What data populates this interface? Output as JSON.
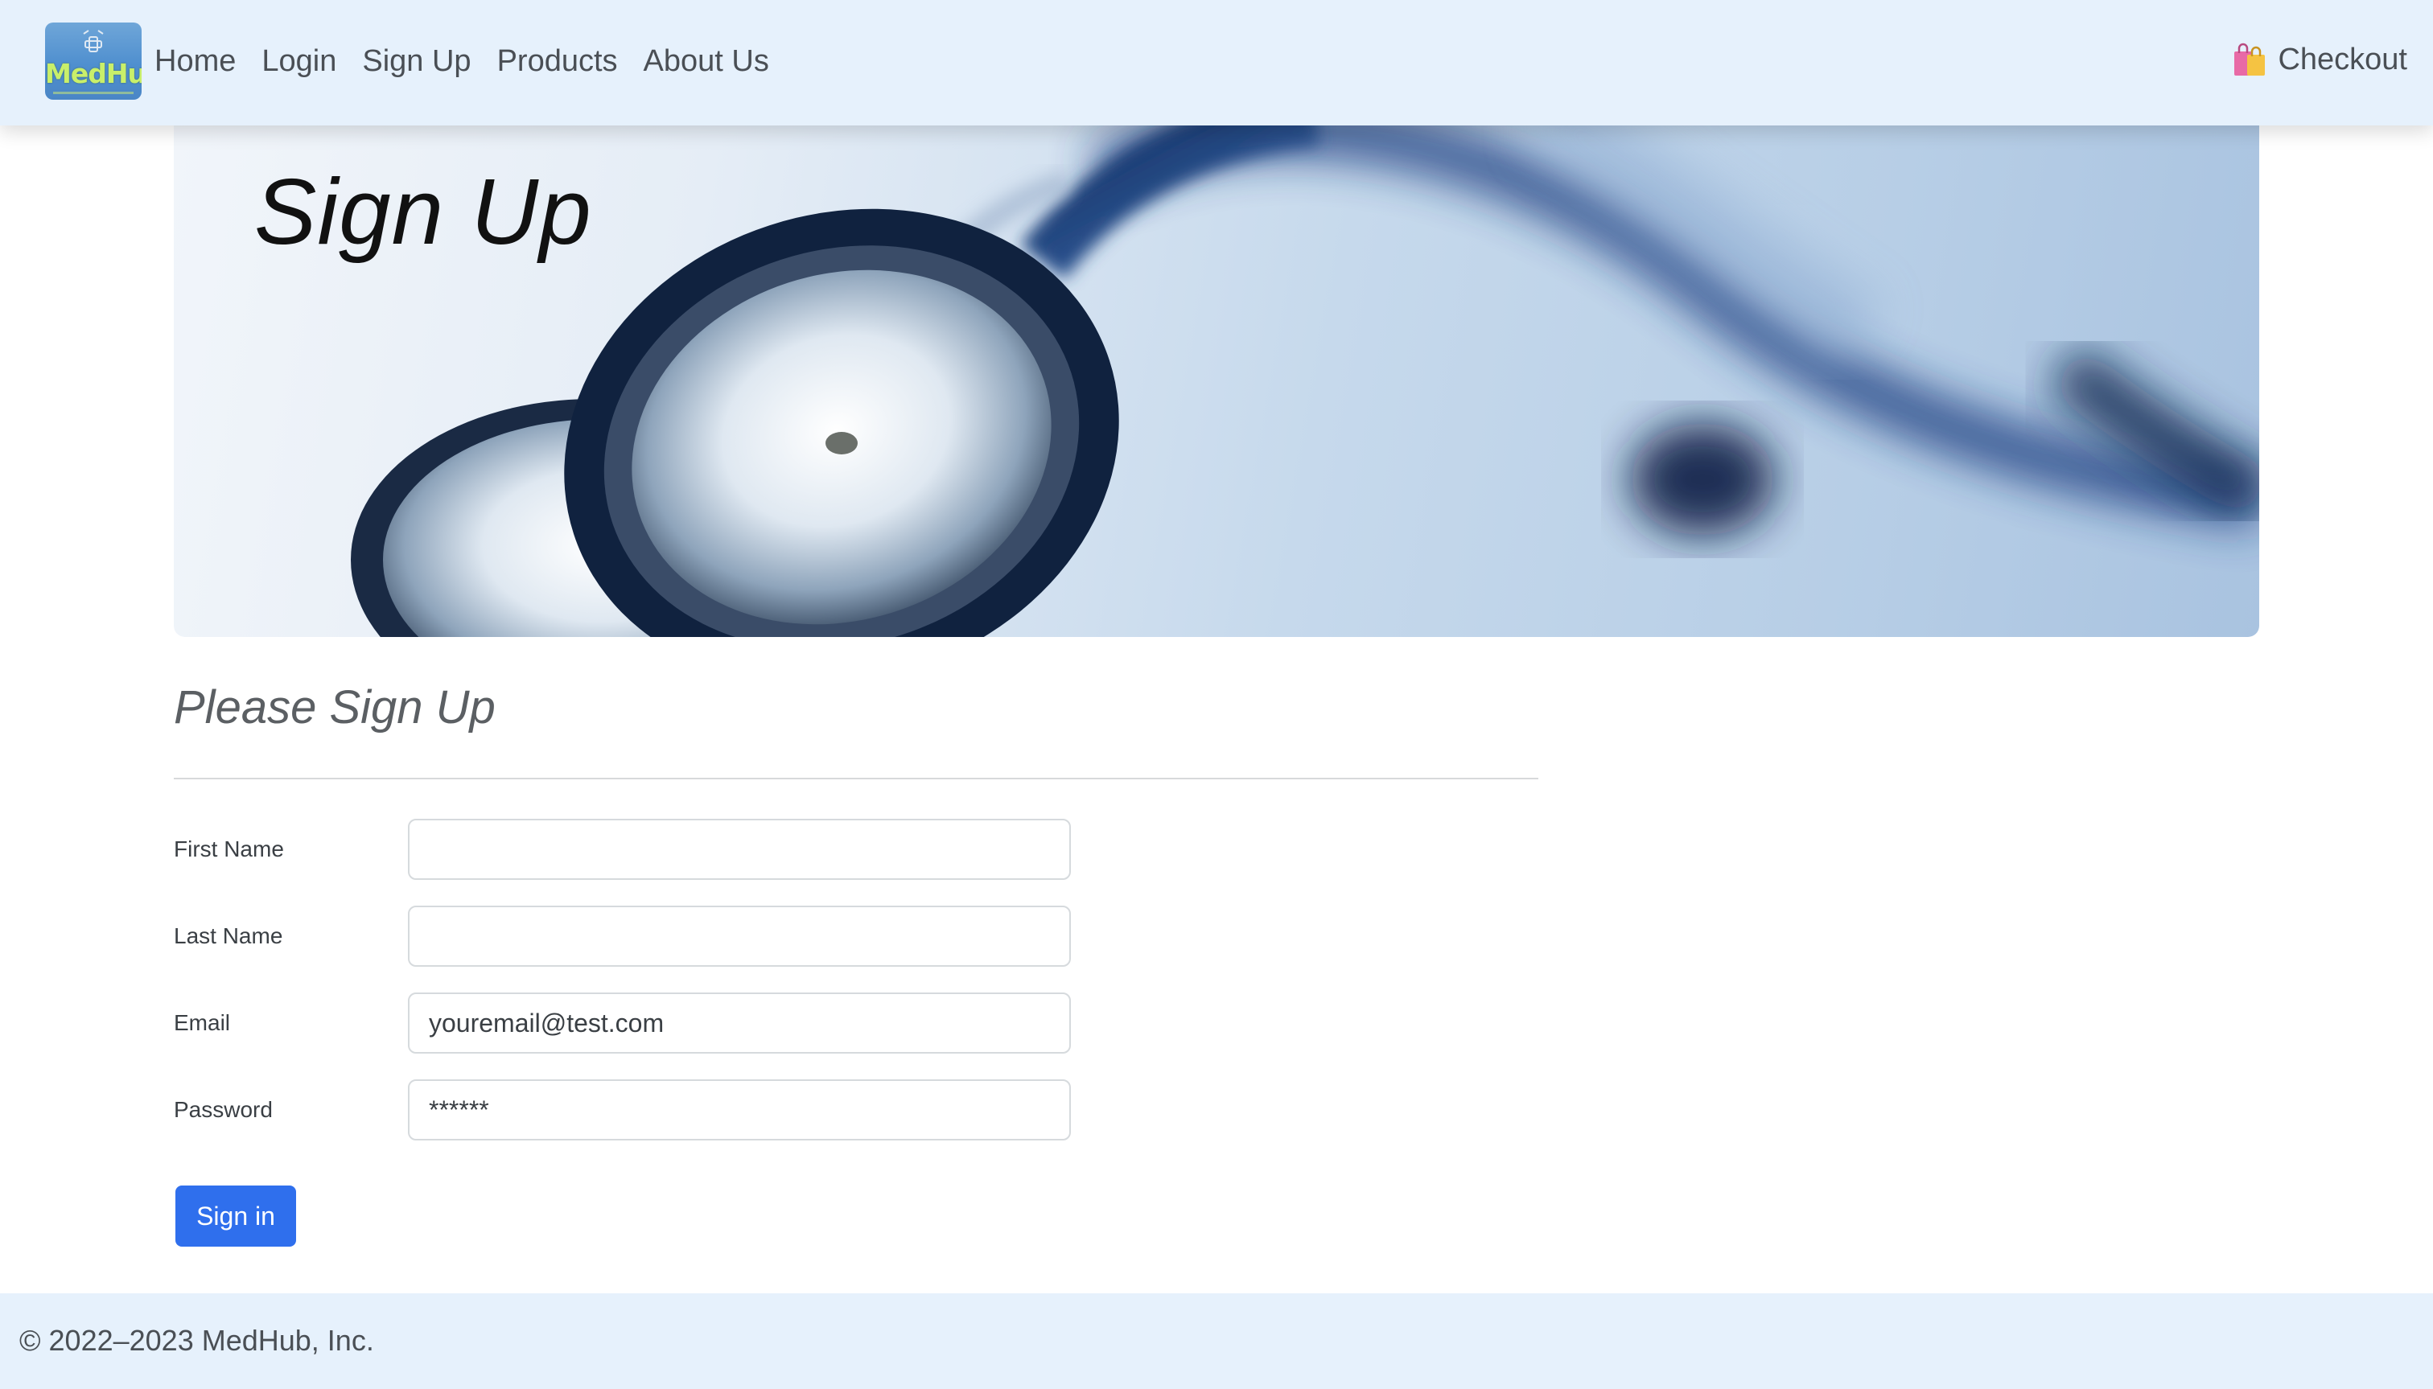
{
  "navbar": {
    "logo_text": "MedHub",
    "links": [
      {
        "label": "Home"
      },
      {
        "label": "Login"
      },
      {
        "label": "Sign Up"
      },
      {
        "label": "Products"
      },
      {
        "label": "About Us"
      }
    ],
    "checkout_label": "Checkout",
    "checkout_icon": "shopping-bags-icon"
  },
  "hero": {
    "title": "Sign Up"
  },
  "form": {
    "heading": "Please Sign Up",
    "fields": [
      {
        "label": "First Name",
        "value": "",
        "placeholder": ""
      },
      {
        "label": "Last Name",
        "value": "",
        "placeholder": ""
      },
      {
        "label": "Email",
        "value": "",
        "placeholder": "youremail@test.com"
      },
      {
        "label": "Password",
        "value": "",
        "placeholder": "******"
      }
    ],
    "submit_label": "Sign in"
  },
  "footer": {
    "copyright": "© 2022–2023 MedHub, Inc."
  },
  "colors": {
    "navbar_bg": "#e6f1fc",
    "primary_button": "#2f6fed",
    "footer_bg": "#e6f1fc"
  }
}
